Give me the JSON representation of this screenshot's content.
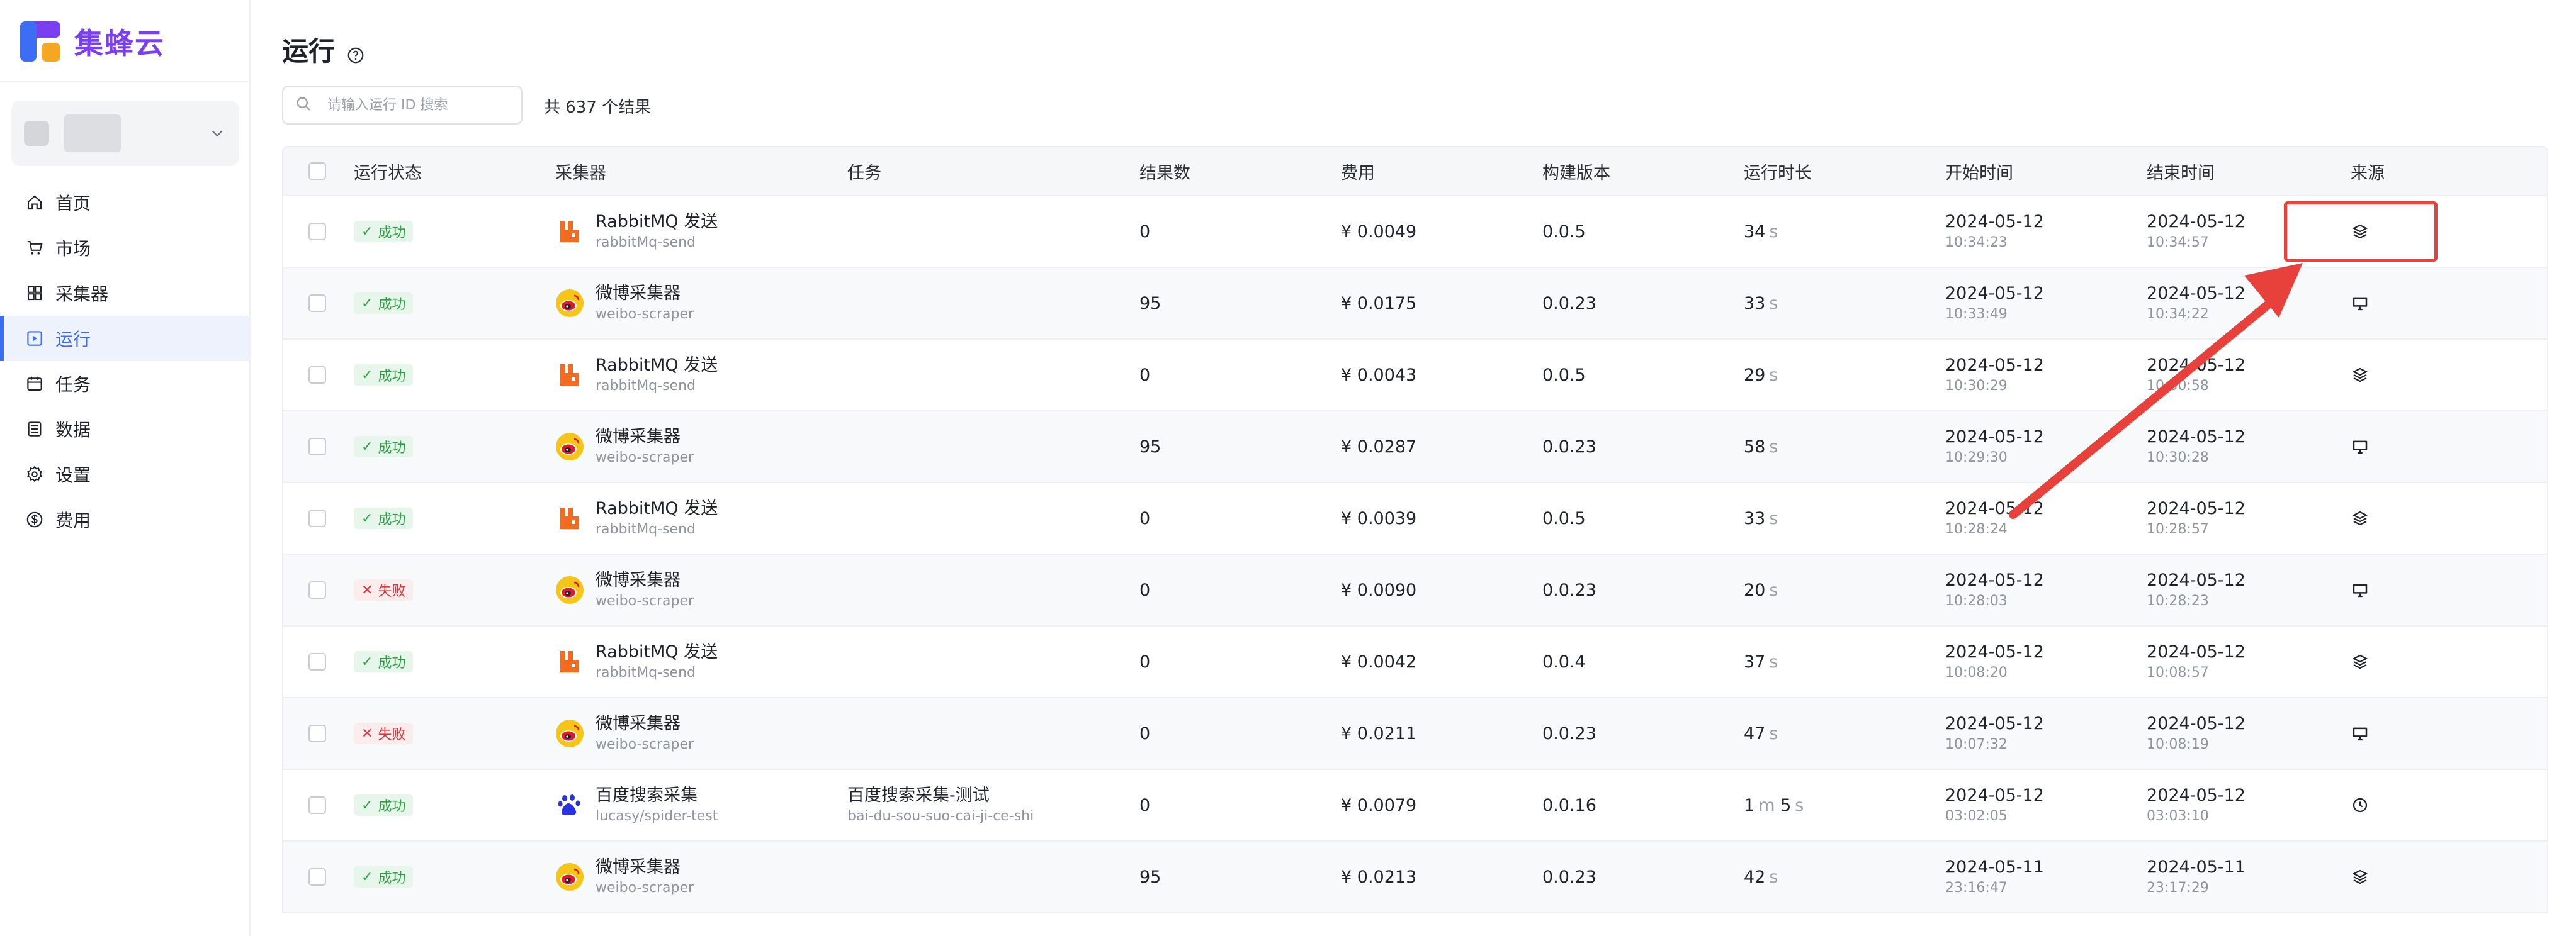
{
  "app": {
    "logo_text": "集蜂云",
    "brand_color": "#7a3ff0",
    "accent_color": "#3b6ef5"
  },
  "sidebar": {
    "workspace_name": "",
    "items": [
      {
        "label": "首页",
        "icon": "home-icon"
      },
      {
        "label": "市场",
        "icon": "cart-icon"
      },
      {
        "label": "采集器",
        "icon": "grid-icon"
      },
      {
        "label": "运行",
        "icon": "play-icon",
        "active": true
      },
      {
        "label": "任务",
        "icon": "calendar-icon"
      },
      {
        "label": "数据",
        "icon": "list-icon"
      },
      {
        "label": "设置",
        "icon": "gear-icon"
      },
      {
        "label": "费用",
        "icon": "dollar-icon"
      }
    ]
  },
  "page": {
    "title": "运行",
    "search_placeholder": "请输入运行 ID 搜索",
    "result_count": "共 637 个结果"
  },
  "table": {
    "columns": [
      "运行状态",
      "采集器",
      "任务",
      "结果数",
      "费用",
      "构建版本",
      "运行时长",
      "开始时间",
      "结束时间",
      "来源"
    ],
    "rows": [
      {
        "status": "成功",
        "ok": true,
        "scraper": "RabbitMQ 发送",
        "scraper_id": "rabbitMq-send",
        "scraper_icon": "rabbitmq-icon",
        "task": "",
        "task_id": "",
        "results": "0",
        "cost": "¥ 0.0049",
        "version": "0.0.5",
        "duration": [
          [
            "34",
            "s"
          ]
        ],
        "start_date": "2024-05-12",
        "start_time": "10:34:23",
        "end_date": "2024-05-12",
        "end_time": "10:34:57",
        "source": "layers-icon"
      },
      {
        "status": "成功",
        "ok": true,
        "scraper": "微博采集器",
        "scraper_id": "weibo-scraper",
        "scraper_icon": "weibo-icon",
        "task": "",
        "task_id": "",
        "results": "95",
        "cost": "¥ 0.0175",
        "version": "0.0.23",
        "duration": [
          [
            "33",
            "s"
          ]
        ],
        "start_date": "2024-05-12",
        "start_time": "10:33:49",
        "end_date": "2024-05-12",
        "end_time": "10:34:22",
        "source": "monitor-icon"
      },
      {
        "status": "成功",
        "ok": true,
        "scraper": "RabbitMQ 发送",
        "scraper_id": "rabbitMq-send",
        "scraper_icon": "rabbitmq-icon",
        "task": "",
        "task_id": "",
        "results": "0",
        "cost": "¥ 0.0043",
        "version": "0.0.5",
        "duration": [
          [
            "29",
            "s"
          ]
        ],
        "start_date": "2024-05-12",
        "start_time": "10:30:29",
        "end_date": "2024-05-12",
        "end_time": "10:30:58",
        "source": "layers-icon"
      },
      {
        "status": "成功",
        "ok": true,
        "scraper": "微博采集器",
        "scraper_id": "weibo-scraper",
        "scraper_icon": "weibo-icon",
        "task": "",
        "task_id": "",
        "results": "95",
        "cost": "¥ 0.0287",
        "version": "0.0.23",
        "duration": [
          [
            "58",
            "s"
          ]
        ],
        "start_date": "2024-05-12",
        "start_time": "10:29:30",
        "end_date": "2024-05-12",
        "end_time": "10:30:28",
        "source": "monitor-icon"
      },
      {
        "status": "成功",
        "ok": true,
        "scraper": "RabbitMQ 发送",
        "scraper_id": "rabbitMq-send",
        "scraper_icon": "rabbitmq-icon",
        "task": "",
        "task_id": "",
        "results": "0",
        "cost": "¥ 0.0039",
        "version": "0.0.5",
        "duration": [
          [
            "33",
            "s"
          ]
        ],
        "start_date": "2024-05-12",
        "start_time": "10:28:24",
        "end_date": "2024-05-12",
        "end_time": "10:28:57",
        "source": "layers-icon"
      },
      {
        "status": "失败",
        "ok": false,
        "scraper": "微博采集器",
        "scraper_id": "weibo-scraper",
        "scraper_icon": "weibo-icon",
        "task": "",
        "task_id": "",
        "results": "0",
        "cost": "¥ 0.0090",
        "version": "0.0.23",
        "duration": [
          [
            "20",
            "s"
          ]
        ],
        "start_date": "2024-05-12",
        "start_time": "10:28:03",
        "end_date": "2024-05-12",
        "end_time": "10:28:23",
        "source": "monitor-icon"
      },
      {
        "status": "成功",
        "ok": true,
        "scraper": "RabbitMQ 发送",
        "scraper_id": "rabbitMq-send",
        "scraper_icon": "rabbitmq-icon",
        "task": "",
        "task_id": "",
        "results": "0",
        "cost": "¥ 0.0042",
        "version": "0.0.4",
        "duration": [
          [
            "37",
            "s"
          ]
        ],
        "start_date": "2024-05-12",
        "start_time": "10:08:20",
        "end_date": "2024-05-12",
        "end_time": "10:08:57",
        "source": "layers-icon"
      },
      {
        "status": "失败",
        "ok": false,
        "scraper": "微博采集器",
        "scraper_id": "weibo-scraper",
        "scraper_icon": "weibo-icon",
        "task": "",
        "task_id": "",
        "results": "0",
        "cost": "¥ 0.0211",
        "version": "0.0.23",
        "duration": [
          [
            "47",
            "s"
          ]
        ],
        "start_date": "2024-05-12",
        "start_time": "10:07:32",
        "end_date": "2024-05-12",
        "end_time": "10:08:19",
        "source": "monitor-icon"
      },
      {
        "status": "成功",
        "ok": true,
        "scraper": "百度搜索采集",
        "scraper_id": "lucasy/spider-test",
        "scraper_icon": "baidu-icon",
        "task": "百度搜索采集-测试",
        "task_id": "bai-du-sou-suo-cai-ji-ce-shi",
        "results": "0",
        "cost": "¥ 0.0079",
        "version": "0.0.16",
        "duration": [
          [
            "1",
            "m"
          ],
          [
            "5",
            "s"
          ]
        ],
        "start_date": "2024-05-12",
        "start_time": "03:02:05",
        "end_date": "2024-05-12",
        "end_time": "03:03:10",
        "source": "clock-icon"
      },
      {
        "status": "成功",
        "ok": true,
        "scraper": "微博采集器",
        "scraper_id": "weibo-scraper",
        "scraper_icon": "weibo-icon",
        "task": "",
        "task_id": "",
        "results": "95",
        "cost": "¥ 0.0213",
        "version": "0.0.23",
        "duration": [
          [
            "42",
            "s"
          ]
        ],
        "start_date": "2024-05-11",
        "start_time": "23:16:47",
        "end_date": "2024-05-11",
        "end_time": "23:17:29",
        "source": "layers-icon"
      }
    ]
  },
  "annotation": {
    "color": "#e8403a"
  }
}
